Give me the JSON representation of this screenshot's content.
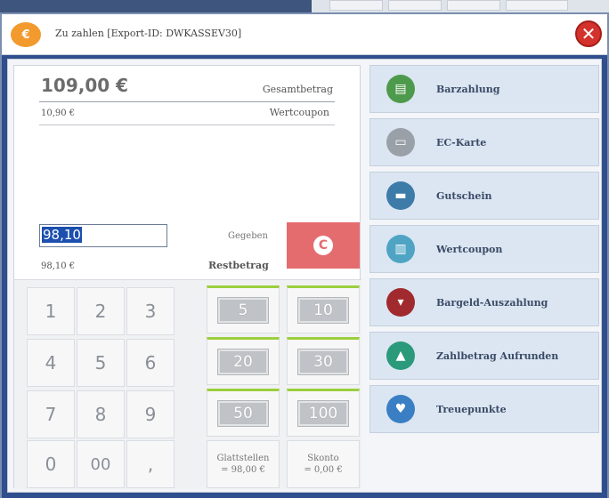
{
  "colors": {
    "accent": "#2f4e8e",
    "clear": "#e46c6f",
    "note_bar": "#9bcf3d",
    "close": "#d4322c"
  },
  "dialog": {
    "title": "Zu zahlen [Export-ID: DWKASSEV30]",
    "title_icon": "coins-hand-icon",
    "close_icon": "close-icon"
  },
  "summary": {
    "total_amount": "109,00 €",
    "total_label": "Gesamtbetrag",
    "coupon_amount": "10,90 €",
    "coupon_label": "Wertcoupon",
    "given_value": "98,10",
    "given_label": "Gegeben",
    "clear_label": "C",
    "rest_amount": "98,10 €",
    "rest_label": "Restbetrag"
  },
  "keypad": [
    "1",
    "2",
    "3",
    "4",
    "5",
    "6",
    "7",
    "8",
    "9",
    "0",
    "00",
    ","
  ],
  "notes": [
    "5",
    "10",
    "20",
    "30",
    "50",
    "100"
  ],
  "actions": {
    "round_label": "Glattstellen",
    "round_value": "= 98,00 €",
    "discount_label": "Skonto",
    "discount_value": "= 0,00 €"
  },
  "payments": [
    {
      "label": "Barzahlung",
      "icon": "cash-register-icon",
      "color": "#4e9a4c"
    },
    {
      "label": "EC-Karte",
      "icon": "card-icon",
      "color": "#9aa0a8"
    },
    {
      "label": "Gutschein",
      "icon": "voucher-icon",
      "color": "#3d7ba8"
    },
    {
      "label": "Wertcoupon",
      "icon": "coupon-icon",
      "color": "#4fa4c4"
    },
    {
      "label": "Bargeld-Auszahlung",
      "icon": "cash-out-icon",
      "color": "#a02a2e"
    },
    {
      "label": "Zahlbetrag Aufrunden",
      "icon": "round-up-icon",
      "color": "#2a9a7a"
    },
    {
      "label": "Treuepunkte",
      "icon": "loyalty-icon",
      "color": "#3a7fc4"
    }
  ]
}
